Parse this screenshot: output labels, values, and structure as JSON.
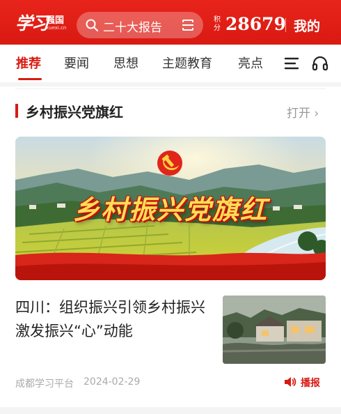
{
  "header": {
    "logo_text": "学习强国",
    "logo_sub": "强国",
    "logo_url": "xuexi.cn",
    "search_placeholder": "二十大报告",
    "points_label": "积分",
    "points_value": "28679",
    "mine_label": "我的"
  },
  "tabs": [
    {
      "label": "推荐",
      "active": true
    },
    {
      "label": "要闻",
      "active": false
    },
    {
      "label": "思想",
      "active": false
    },
    {
      "label": "主题教育",
      "active": false
    },
    {
      "label": "亮点",
      "active": false
    }
  ],
  "section": {
    "title": "乡村振兴党旗红",
    "open_label": "打开 ›"
  },
  "banner": {
    "title": "乡村振兴党旗红"
  },
  "article": {
    "title": "四川：组织振兴引领乡村振兴 激发振兴“心”动能",
    "source": "成都学习平台",
    "date": "2024-02-29",
    "play_label": "播报"
  },
  "icons": {
    "search": "search-icon",
    "scan": "scan-icon",
    "menu": "menu-icon",
    "headphone": "headphone-icon",
    "speaker": "speaker-icon",
    "emblem": "party-emblem-icon"
  },
  "colors": {
    "brand_red": "#d91a12",
    "text_dark": "#222222",
    "text_muted": "#999999"
  }
}
